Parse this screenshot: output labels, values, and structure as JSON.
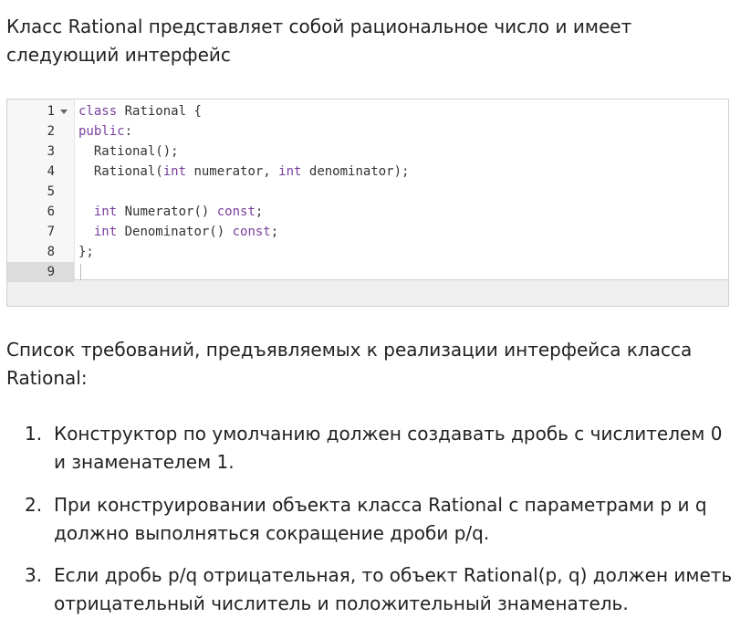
{
  "intro_text": "Класс Rational представляет собой рациональное число и имеет следующий интерфейс",
  "code": {
    "lines": [
      {
        "num": "1",
        "parts": [
          {
            "t": "class",
            "kw": true
          },
          {
            "t": " Rational {"
          }
        ]
      },
      {
        "num": "2",
        "parts": [
          {
            "t": "public",
            "kw": true
          },
          {
            "t": ":"
          }
        ]
      },
      {
        "num": "3",
        "parts": [
          {
            "t": "  Rational();"
          }
        ]
      },
      {
        "num": "4",
        "parts": [
          {
            "t": "  Rational("
          },
          {
            "t": "int",
            "kw": true
          },
          {
            "t": " numerator, "
          },
          {
            "t": "int",
            "kw": true
          },
          {
            "t": " denominator);"
          }
        ]
      },
      {
        "num": "5",
        "parts": [
          {
            "t": ""
          }
        ]
      },
      {
        "num": "6",
        "parts": [
          {
            "t": "  "
          },
          {
            "t": "int",
            "kw": true
          },
          {
            "t": " Numerator() "
          },
          {
            "t": "const",
            "kw": true
          },
          {
            "t": ";"
          }
        ]
      },
      {
        "num": "7",
        "parts": [
          {
            "t": "  "
          },
          {
            "t": "int",
            "kw": true
          },
          {
            "t": " Denominator() "
          },
          {
            "t": "const",
            "kw": true
          },
          {
            "t": ";"
          }
        ]
      },
      {
        "num": "8",
        "parts": [
          {
            "t": "};"
          }
        ]
      },
      {
        "num": "9",
        "parts": [
          {
            "t": ""
          }
        ]
      }
    ],
    "active_line": 9,
    "fold_line": 1
  },
  "requirements_intro": "Список требований, предъявляемых к реализации интерфейса класса Rational:",
  "requirements": [
    {
      "num": "1.",
      "text": "Конструктор по умолчанию должен создавать дробь с числителем 0 и знаменателем 1."
    },
    {
      "num": "2.",
      "text": "При конструировании объекта класса Rational с параметрами p и q должно выполняться сокращение дроби p/q."
    },
    {
      "num": "3.",
      "text": "Если дробь p/q отрицательная, то объект Rational(p, q) должен иметь отрицательный числитель и положительный знаменатель."
    }
  ],
  "colors": {
    "keyword": "#7a3e9d",
    "text": "#222222",
    "gutter_active": "#dcdcdc"
  }
}
